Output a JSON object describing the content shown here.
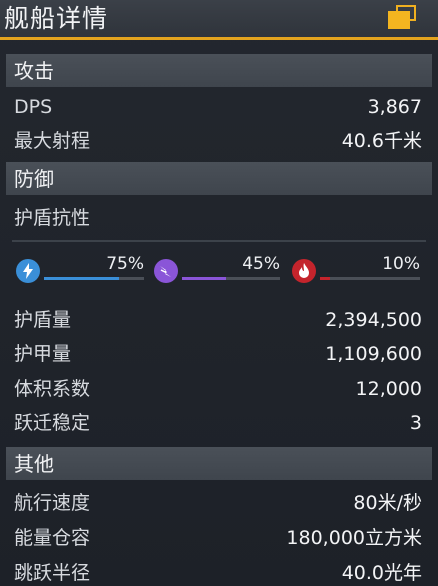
{
  "window": {
    "title": "舰船详情",
    "icon": "window-icon",
    "accent": "#e3a31e"
  },
  "attack": {
    "header": "攻击",
    "rows": [
      {
        "label": "DPS",
        "value": "3,867"
      },
      {
        "label": "最大射程",
        "value": "40.6千米"
      }
    ]
  },
  "defense": {
    "header": "防御",
    "shield_resist_label": "护盾抗性",
    "resists": [
      {
        "icon": "lightning-icon",
        "percent_text": "75%",
        "fraction": 0.75,
        "color": "#3a8fd8"
      },
      {
        "icon": "energy-icon",
        "percent_text": "45%",
        "fraction": 0.45,
        "color": "#8a55d8"
      },
      {
        "icon": "fire-icon",
        "percent_text": "10%",
        "fraction": 0.1,
        "color": "#c4242c"
      }
    ],
    "rows": [
      {
        "label": "护盾量",
        "value": "2,394,500"
      },
      {
        "label": "护甲量",
        "value": "1,109,600"
      },
      {
        "label": "体积系数",
        "value": "12,000"
      },
      {
        "label": "跃迁稳定",
        "value": "3"
      }
    ]
  },
  "other": {
    "header": "其他",
    "rows": [
      {
        "label": "航行速度",
        "value": "80米/秒"
      },
      {
        "label": "能量仓容",
        "value": "180,000立方米"
      },
      {
        "label": "跳跃半径",
        "value": "40.0光年"
      }
    ]
  }
}
